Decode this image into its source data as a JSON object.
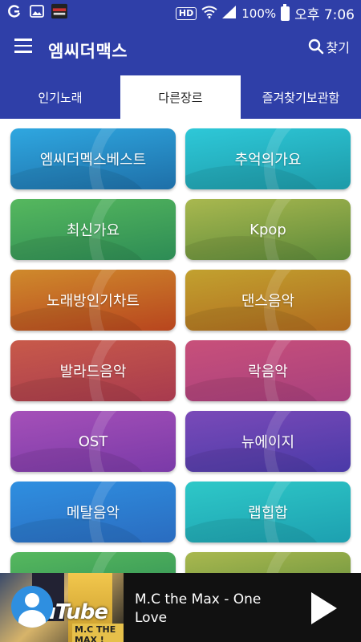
{
  "status_bar": {
    "hd_label": "HD",
    "battery": "100%",
    "time": "오후 7:06",
    "icons": [
      "g-app-icon",
      "image-icon",
      "app-thumbnail-icon",
      "wifi-icon",
      "signal-icon",
      "battery-icon"
    ]
  },
  "app_bar": {
    "title": "엠씨더맥스",
    "search_label": "찾기",
    "color": "#2f3fa8"
  },
  "tabs": [
    {
      "label": "인기노래",
      "active": false
    },
    {
      "label": "다른장르",
      "active": true
    },
    {
      "label": "즐겨찾기보관함",
      "active": false
    }
  ],
  "genres": [
    {
      "label": "엠씨더멕스베스트",
      "color_top": "#2fa7e0",
      "color_bottom": "#1e6fa8"
    },
    {
      "label": "추억의가요",
      "color_top": "#2ec8d8",
      "color_bottom": "#1d9aa8"
    },
    {
      "label": "최신가요",
      "color_top": "#56b85e",
      "color_bottom": "#2d8c55"
    },
    {
      "label": "Kpop",
      "color_top": "#a9b84f",
      "color_bottom": "#5c8a3a"
    },
    {
      "label": "노래방인기차트",
      "color_top": "#cf8a2c",
      "color_bottom": "#b8451e"
    },
    {
      "label": "댄스음악",
      "color_top": "#c2a12f",
      "color_bottom": "#b06a1e"
    },
    {
      "label": "발라드음악",
      "color_top": "#c85a4a",
      "color_bottom": "#a83a4e"
    },
    {
      "label": "락음악",
      "color_top": "#c8507a",
      "color_bottom": "#a8407e"
    },
    {
      "label": "OST",
      "color_top": "#a550b8",
      "color_bottom": "#7a3aa8"
    },
    {
      "label": "뉴에이지",
      "color_top": "#7a4ab8",
      "color_bottom": "#4a3aa8"
    },
    {
      "label": "메탈음악",
      "color_top": "#2f8fe0",
      "color_bottom": "#2a6cc0"
    },
    {
      "label": "랩힙합",
      "color_top": "#2ec8c8",
      "color_bottom": "#1da0b0"
    },
    {
      "label": "",
      "color_top": "#56b85e",
      "color_bottom": "#2d8c55"
    },
    {
      "label": "",
      "color_top": "#a9b84f",
      "color_bottom": "#5c8a3a"
    }
  ],
  "player": {
    "thumbnail_logo": "YouTube",
    "thumbnail_badge": "M.C THE MAX !",
    "track_title": "M.C the Max - One Love",
    "play_icon": "play-icon"
  }
}
